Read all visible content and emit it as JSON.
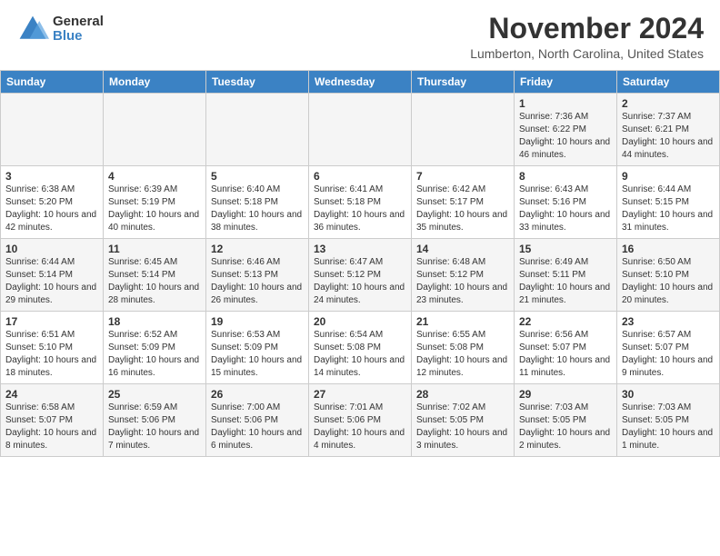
{
  "header": {
    "logo_general": "General",
    "logo_blue": "Blue",
    "month_title": "November 2024",
    "location": "Lumberton, North Carolina, United States"
  },
  "days_of_week": [
    "Sunday",
    "Monday",
    "Tuesday",
    "Wednesday",
    "Thursday",
    "Friday",
    "Saturday"
  ],
  "weeks": [
    [
      {
        "day": "",
        "info": ""
      },
      {
        "day": "",
        "info": ""
      },
      {
        "day": "",
        "info": ""
      },
      {
        "day": "",
        "info": ""
      },
      {
        "day": "",
        "info": ""
      },
      {
        "day": "1",
        "info": "Sunrise: 7:36 AM\nSunset: 6:22 PM\nDaylight: 10 hours and 46 minutes."
      },
      {
        "day": "2",
        "info": "Sunrise: 7:37 AM\nSunset: 6:21 PM\nDaylight: 10 hours and 44 minutes."
      }
    ],
    [
      {
        "day": "3",
        "info": "Sunrise: 6:38 AM\nSunset: 5:20 PM\nDaylight: 10 hours and 42 minutes."
      },
      {
        "day": "4",
        "info": "Sunrise: 6:39 AM\nSunset: 5:19 PM\nDaylight: 10 hours and 40 minutes."
      },
      {
        "day": "5",
        "info": "Sunrise: 6:40 AM\nSunset: 5:18 PM\nDaylight: 10 hours and 38 minutes."
      },
      {
        "day": "6",
        "info": "Sunrise: 6:41 AM\nSunset: 5:18 PM\nDaylight: 10 hours and 36 minutes."
      },
      {
        "day": "7",
        "info": "Sunrise: 6:42 AM\nSunset: 5:17 PM\nDaylight: 10 hours and 35 minutes."
      },
      {
        "day": "8",
        "info": "Sunrise: 6:43 AM\nSunset: 5:16 PM\nDaylight: 10 hours and 33 minutes."
      },
      {
        "day": "9",
        "info": "Sunrise: 6:44 AM\nSunset: 5:15 PM\nDaylight: 10 hours and 31 minutes."
      }
    ],
    [
      {
        "day": "10",
        "info": "Sunrise: 6:44 AM\nSunset: 5:14 PM\nDaylight: 10 hours and 29 minutes."
      },
      {
        "day": "11",
        "info": "Sunrise: 6:45 AM\nSunset: 5:14 PM\nDaylight: 10 hours and 28 minutes."
      },
      {
        "day": "12",
        "info": "Sunrise: 6:46 AM\nSunset: 5:13 PM\nDaylight: 10 hours and 26 minutes."
      },
      {
        "day": "13",
        "info": "Sunrise: 6:47 AM\nSunset: 5:12 PM\nDaylight: 10 hours and 24 minutes."
      },
      {
        "day": "14",
        "info": "Sunrise: 6:48 AM\nSunset: 5:12 PM\nDaylight: 10 hours and 23 minutes."
      },
      {
        "day": "15",
        "info": "Sunrise: 6:49 AM\nSunset: 5:11 PM\nDaylight: 10 hours and 21 minutes."
      },
      {
        "day": "16",
        "info": "Sunrise: 6:50 AM\nSunset: 5:10 PM\nDaylight: 10 hours and 20 minutes."
      }
    ],
    [
      {
        "day": "17",
        "info": "Sunrise: 6:51 AM\nSunset: 5:10 PM\nDaylight: 10 hours and 18 minutes."
      },
      {
        "day": "18",
        "info": "Sunrise: 6:52 AM\nSunset: 5:09 PM\nDaylight: 10 hours and 16 minutes."
      },
      {
        "day": "19",
        "info": "Sunrise: 6:53 AM\nSunset: 5:09 PM\nDaylight: 10 hours and 15 minutes."
      },
      {
        "day": "20",
        "info": "Sunrise: 6:54 AM\nSunset: 5:08 PM\nDaylight: 10 hours and 14 minutes."
      },
      {
        "day": "21",
        "info": "Sunrise: 6:55 AM\nSunset: 5:08 PM\nDaylight: 10 hours and 12 minutes."
      },
      {
        "day": "22",
        "info": "Sunrise: 6:56 AM\nSunset: 5:07 PM\nDaylight: 10 hours and 11 minutes."
      },
      {
        "day": "23",
        "info": "Sunrise: 6:57 AM\nSunset: 5:07 PM\nDaylight: 10 hours and 9 minutes."
      }
    ],
    [
      {
        "day": "24",
        "info": "Sunrise: 6:58 AM\nSunset: 5:07 PM\nDaylight: 10 hours and 8 minutes."
      },
      {
        "day": "25",
        "info": "Sunrise: 6:59 AM\nSunset: 5:06 PM\nDaylight: 10 hours and 7 minutes."
      },
      {
        "day": "26",
        "info": "Sunrise: 7:00 AM\nSunset: 5:06 PM\nDaylight: 10 hours and 6 minutes."
      },
      {
        "day": "27",
        "info": "Sunrise: 7:01 AM\nSunset: 5:06 PM\nDaylight: 10 hours and 4 minutes."
      },
      {
        "day": "28",
        "info": "Sunrise: 7:02 AM\nSunset: 5:05 PM\nDaylight: 10 hours and 3 minutes."
      },
      {
        "day": "29",
        "info": "Sunrise: 7:03 AM\nSunset: 5:05 PM\nDaylight: 10 hours and 2 minutes."
      },
      {
        "day": "30",
        "info": "Sunrise: 7:03 AM\nSunset: 5:05 PM\nDaylight: 10 hours and 1 minute."
      }
    ]
  ]
}
